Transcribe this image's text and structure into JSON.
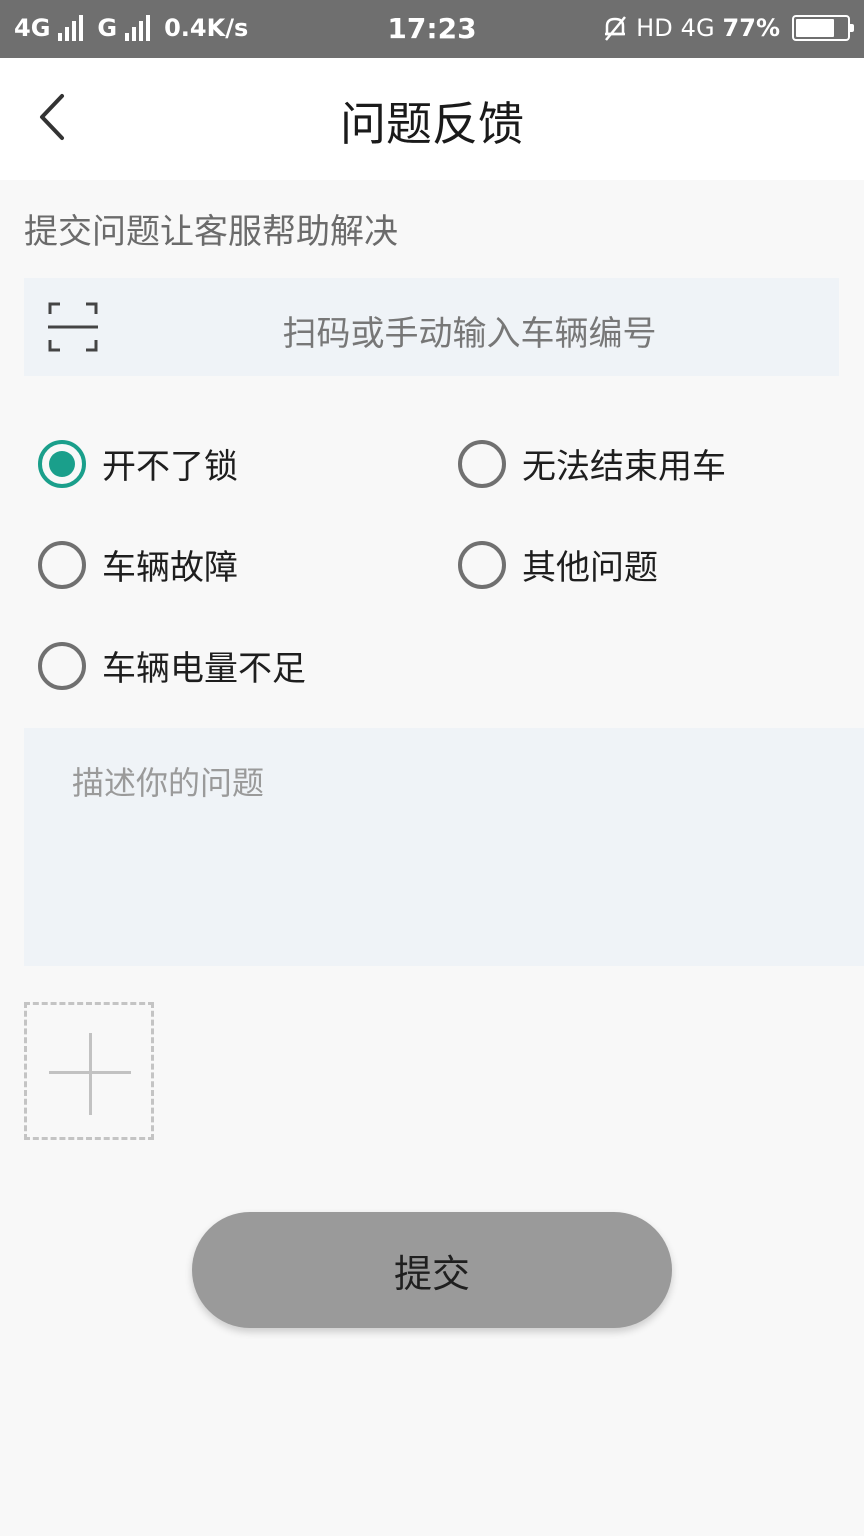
{
  "status_bar": {
    "network1": "4G",
    "network2": "G",
    "speed": "0.4K/s",
    "time": "17:23",
    "hd": "HD",
    "network3": "4G",
    "battery": "77%",
    "battery_level": 0.77
  },
  "header": {
    "title": "问题反馈",
    "back_icon": "chevron-left-icon"
  },
  "form": {
    "hint": "提交问题让客服帮助解决",
    "scan_icon": "scan-frame-icon",
    "scan_placeholder": "扫码或手动输入车辆编号",
    "options": [
      {
        "label": "开不了锁",
        "checked": true
      },
      {
        "label": "无法结束用车",
        "checked": false
      },
      {
        "label": "车辆故障",
        "checked": false
      },
      {
        "label": "其他问题",
        "checked": false
      },
      {
        "label": "车辆电量不足",
        "checked": false
      }
    ],
    "description_placeholder": "描述你的问题",
    "add_photo_icon": "plus-icon",
    "submit_label": "提交"
  },
  "colors": {
    "accent": "#1a9f8b",
    "status_bar_bg": "#6f6f6f",
    "input_bg": "#eff3f7",
    "submit_bg": "#9a9a9a"
  }
}
